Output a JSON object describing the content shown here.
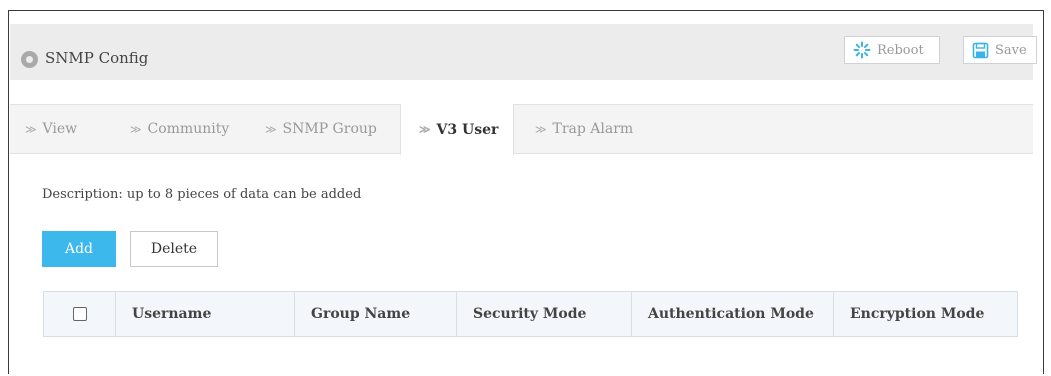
{
  "header": {
    "title": "SNMP Config",
    "reboot_label": "Reboot",
    "save_label": "Save"
  },
  "tabs": [
    {
      "label": "View",
      "active": false
    },
    {
      "label": "Community",
      "active": false
    },
    {
      "label": "SNMP Group",
      "active": false
    },
    {
      "label": "V3 User",
      "active": true
    },
    {
      "label": "Trap Alarm",
      "active": false
    }
  ],
  "main": {
    "description": "Description: up to 8 pieces of data can be added",
    "add_label": "Add",
    "delete_label": "Delete"
  },
  "table": {
    "columns": [
      "Username",
      "Group Name",
      "Security Mode",
      "Authentication Mode",
      "Encryption Mode"
    ],
    "rows": []
  },
  "colors": {
    "accent": "#3db8ec",
    "header_bg": "#ececec",
    "tab_bg": "#f4f4f4",
    "table_header_bg": "#f3f6fa"
  },
  "icons": {
    "title": "location-pin-icon",
    "reboot": "reboot-icon",
    "save": "floppy-disk-icon",
    "tab": "chevron-right-icon"
  }
}
